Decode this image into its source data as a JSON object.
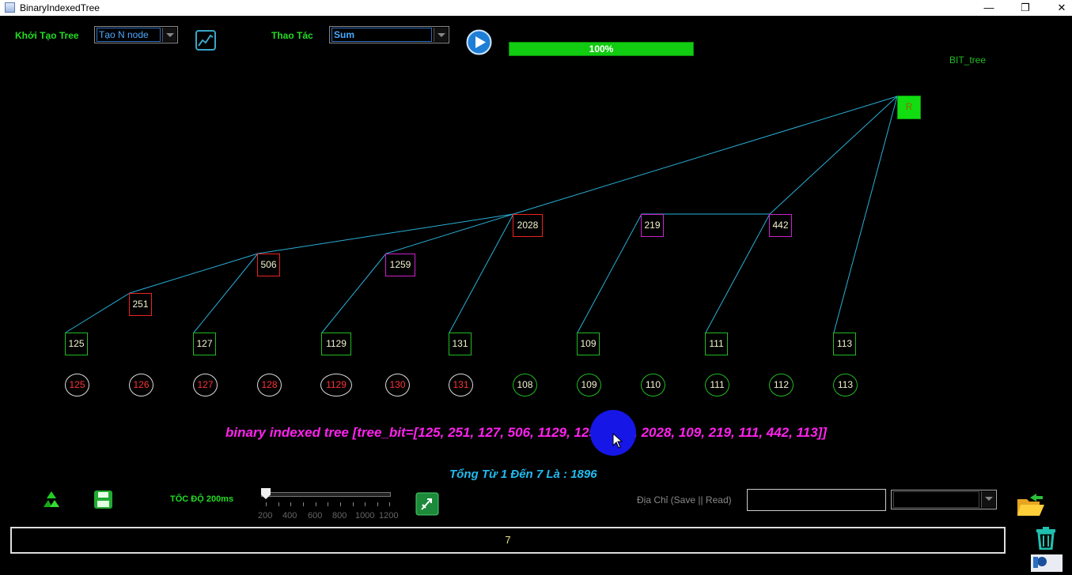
{
  "window": {
    "title": "BinaryIndexedTree",
    "min": "—",
    "restore": "❐",
    "close": "✕"
  },
  "toolbar": {
    "init_label": "Khởi Tạo Tree",
    "init_select": "Tạo N node",
    "op_label": "Thao Tác",
    "op_select": "Sum",
    "progress_text": "100%",
    "progress_value": 1.0
  },
  "tree_label": "BIT_tree",
  "root_label": "R",
  "tree_nodes": [
    {
      "value": "125",
      "color": "#22bb22"
    },
    {
      "value": "251",
      "color": "#ee2222"
    },
    {
      "value": "127",
      "color": "#22bb22"
    },
    {
      "value": "506",
      "color": "#ee2222"
    },
    {
      "value": "1129",
      "color": "#22bb22"
    },
    {
      "value": "1259",
      "color": "#cc22cc"
    },
    {
      "value": "131",
      "color": "#22bb22"
    },
    {
      "value": "2028",
      "color": "#ee2222"
    },
    {
      "value": "109",
      "color": "#22bb22"
    },
    {
      "value": "219",
      "color": "#cc22cc"
    },
    {
      "value": "111",
      "color": "#22bb22"
    },
    {
      "value": "442",
      "color": "#cc22cc"
    },
    {
      "value": "113",
      "color": "#22bb22"
    }
  ],
  "array_nodes": [
    {
      "value": "125",
      "text_color": "#ff3333",
      "border": "#dddddd"
    },
    {
      "value": "126",
      "text_color": "#ff3333",
      "border": "#dddddd"
    },
    {
      "value": "127",
      "text_color": "#ff3333",
      "border": "#dddddd"
    },
    {
      "value": "128",
      "text_color": "#ff3333",
      "border": "#dddddd"
    },
    {
      "value": "1129",
      "text_color": "#ff3333",
      "border": "#dddddd"
    },
    {
      "value": "130",
      "text_color": "#ff3333",
      "border": "#dddddd"
    },
    {
      "value": "131",
      "text_color": "#ff3333",
      "border": "#dddddd"
    },
    {
      "value": "108",
      "text_color": "#f4f4d0",
      "border": "#22bb22"
    },
    {
      "value": "109",
      "text_color": "#f4f4d0",
      "border": "#22bb22"
    },
    {
      "value": "110",
      "text_color": "#f4f4d0",
      "border": "#22bb22"
    },
    {
      "value": "111",
      "text_color": "#f4f4d0",
      "border": "#22bb22"
    },
    {
      "value": "112",
      "text_color": "#f4f4d0",
      "border": "#22bb22"
    },
    {
      "value": "113",
      "text_color": "#f4f4d0",
      "border": "#22bb22"
    }
  ],
  "bit_text": "binary indexed tree [tree_bit=[125, 251, 127, 506, 1129, 1259, 131, 2028, 109, 219, 111, 442, 113]]",
  "sum_text": "Tổng Từ 1 Đến 7 Là : 1896",
  "controls": {
    "speed_label": "TỐC ĐỘ 200ms",
    "speed_value": 200,
    "slider_ticks": [
      "200",
      "400",
      "600",
      "800",
      "1000",
      "1200"
    ],
    "address_label": "Địa Chỉ (Save || Read)",
    "address_value": "",
    "address_select": ""
  },
  "status_value": "7",
  "colors": {
    "edge": "#2ab0d8",
    "root": "#11dd11",
    "accent_green": "#22dd22"
  },
  "icons": [
    "chart-icon",
    "play-icon",
    "recycle-icon",
    "save-icon",
    "run-icon",
    "open-folder-icon",
    "trash-icon"
  ]
}
